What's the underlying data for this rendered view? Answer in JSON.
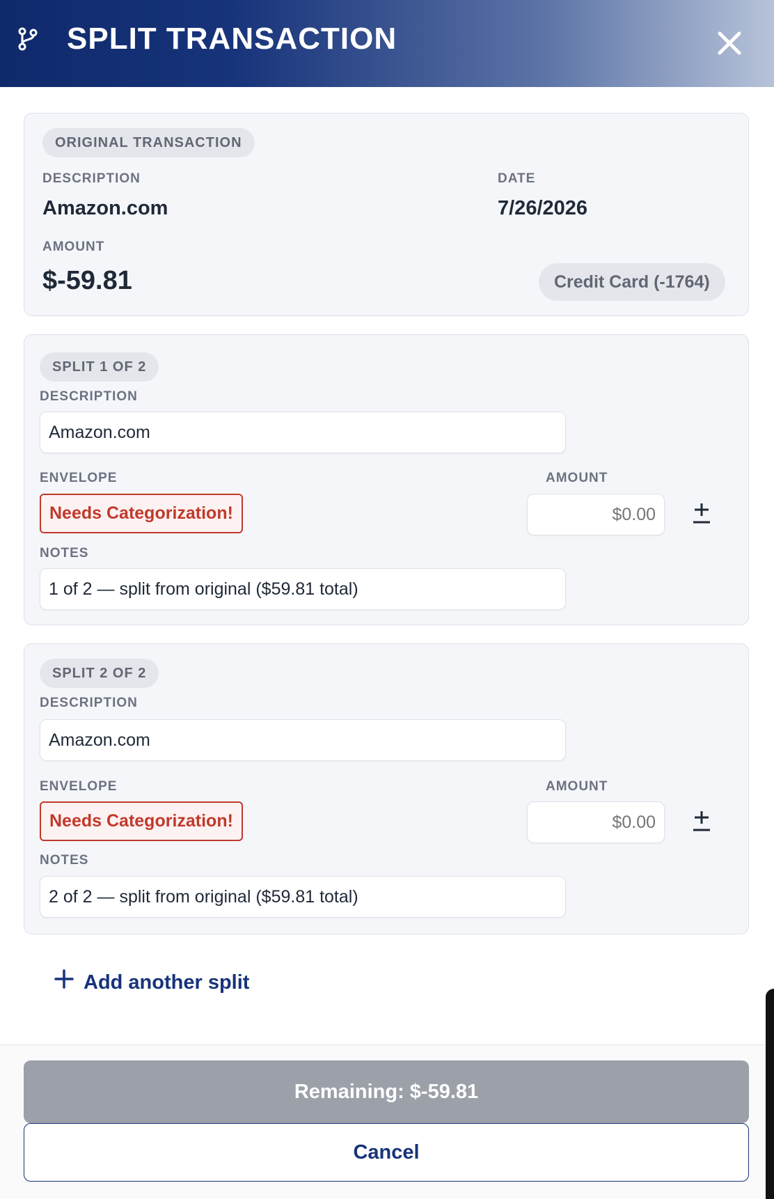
{
  "header": {
    "title": "SPLIT TRANSACTION",
    "icon": "branch-icon",
    "close_icon": "close-icon"
  },
  "original": {
    "badge": "ORIGINAL TRANSACTION",
    "description_label": "DESCRIPTION",
    "description": "Amazon.com",
    "date_label": "DATE",
    "date": "7/26/2026",
    "amount_label": "AMOUNT",
    "amount": "$-59.81",
    "account": "Credit Card (-1764)"
  },
  "splits": [
    {
      "badge": "SPLIT 1 OF 2",
      "description_label": "DESCRIPTION",
      "description": "Amazon.com",
      "envelope_label": "ENVELOPE",
      "envelope": "Needs Categorization!",
      "amount_label": "AMOUNT",
      "amount_placeholder": "$0.00",
      "notes_label": "NOTES",
      "notes": "1 of 2 — split from original ($59.81 total)"
    },
    {
      "badge": "SPLIT 2 OF 2",
      "description_label": "DESCRIPTION",
      "description": "Amazon.com",
      "envelope_label": "ENVELOPE",
      "envelope": "Needs Categorization!",
      "amount_label": "AMOUNT",
      "amount_placeholder": "$0.00",
      "notes_label": "NOTES",
      "notes": "2 of 2 — split from original ($59.81 total)"
    }
  ],
  "add_split_label": "Add another split",
  "footer": {
    "remaining_label": "Remaining: $-59.81",
    "cancel_label": "Cancel"
  },
  "colors": {
    "header_start": "#0f2a6b",
    "header_end": "#b7c3d9",
    "accent": "#17337a",
    "error": "#c0392b",
    "disabled": "#9ca0a8"
  }
}
